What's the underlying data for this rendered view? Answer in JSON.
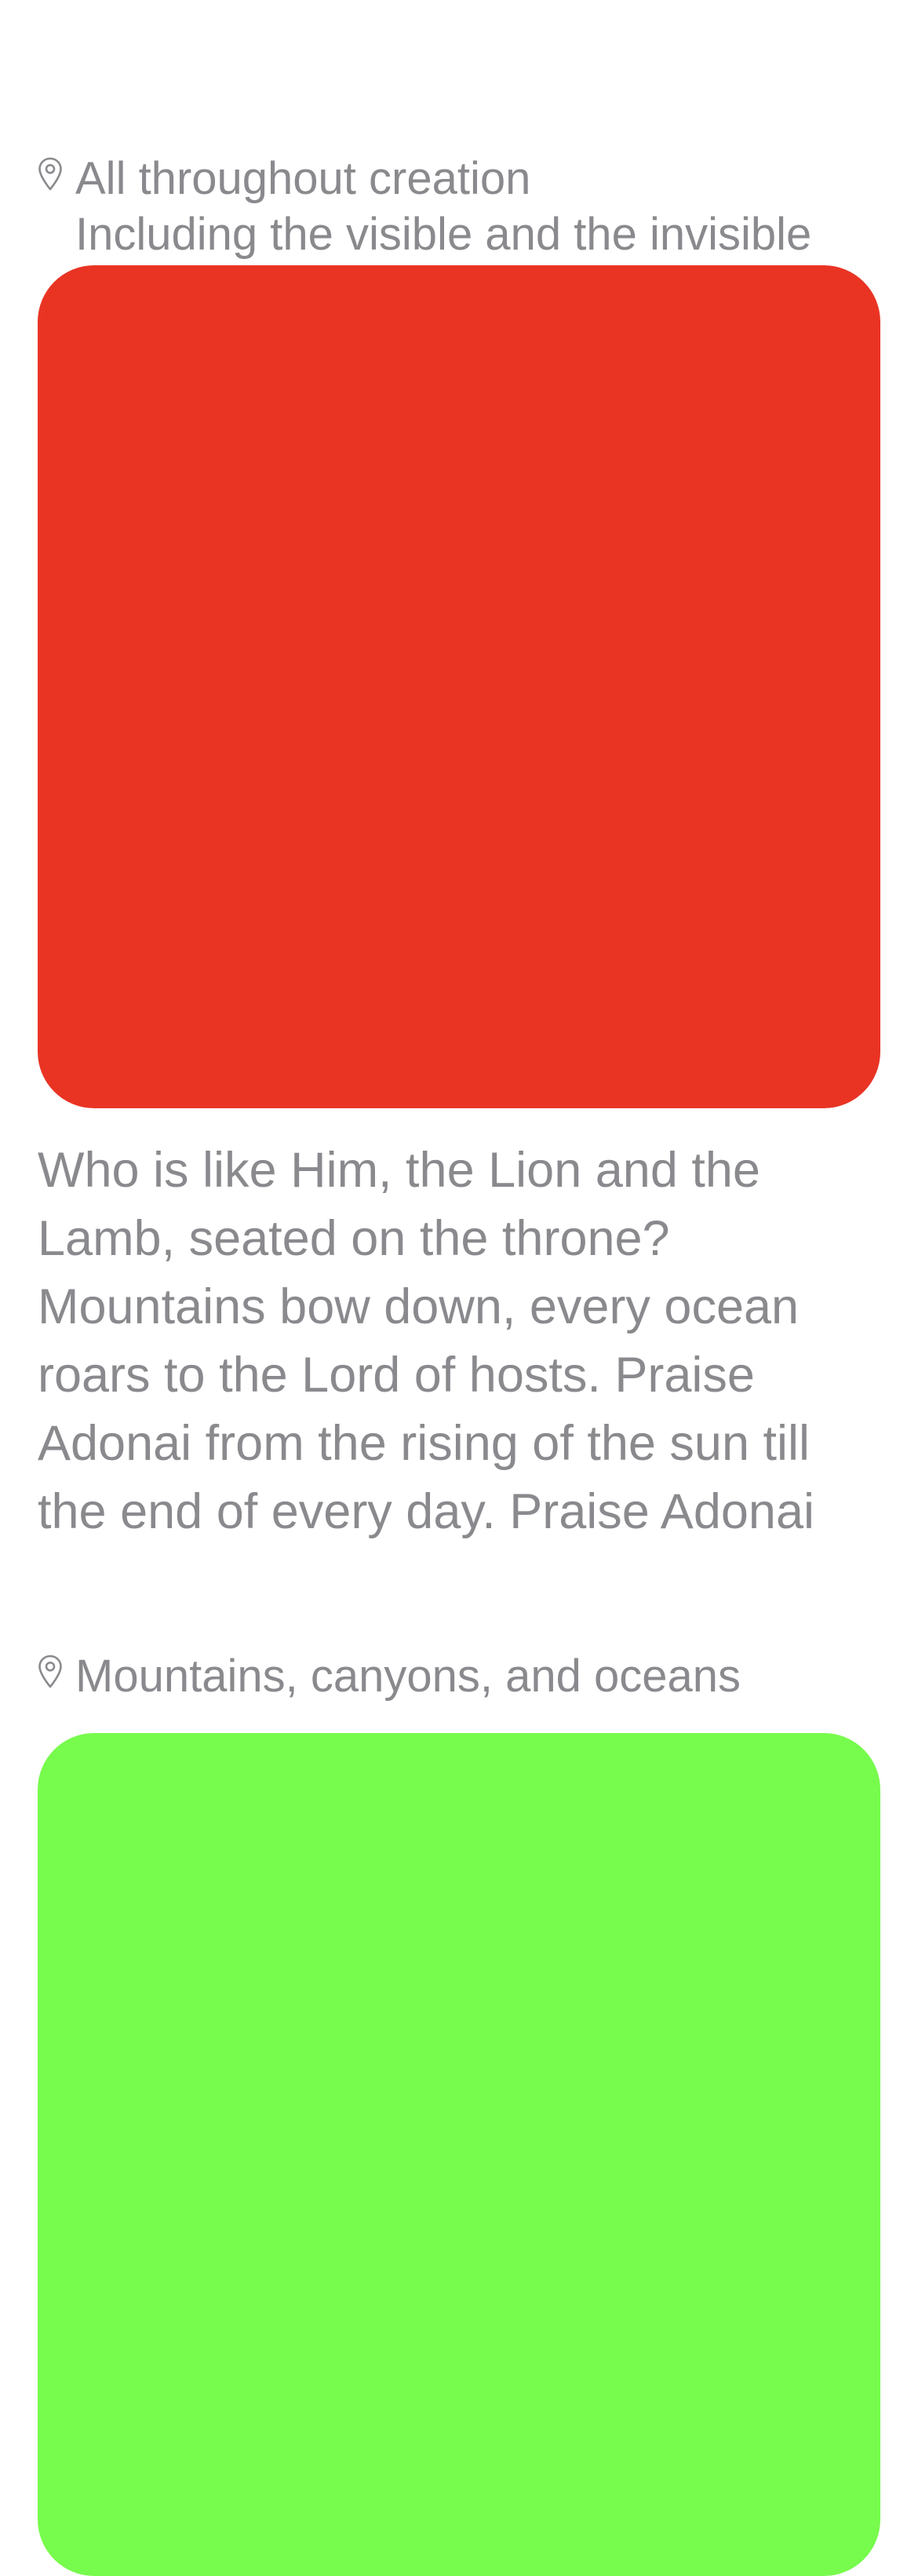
{
  "posts": [
    {
      "location": "All throughout creation",
      "sublocation": "Including the visible and the invisible",
      "media_color": "#e93424",
      "caption": "Who is like Him, the Lion and the Lamb, seated on the throne? Mountains bow down, every ocean roars to the Lord of hosts. Praise Adonai from the rising of the sun till the end of every day. Praise Adonai"
    },
    {
      "location": "Mountains, canyons, and oceans",
      "media_color": "#77fb4d"
    }
  ],
  "icons": {
    "location": "map-pin-icon"
  },
  "colors": {
    "text_secondary": "#8a8a8e",
    "background": "#ffffff"
  }
}
